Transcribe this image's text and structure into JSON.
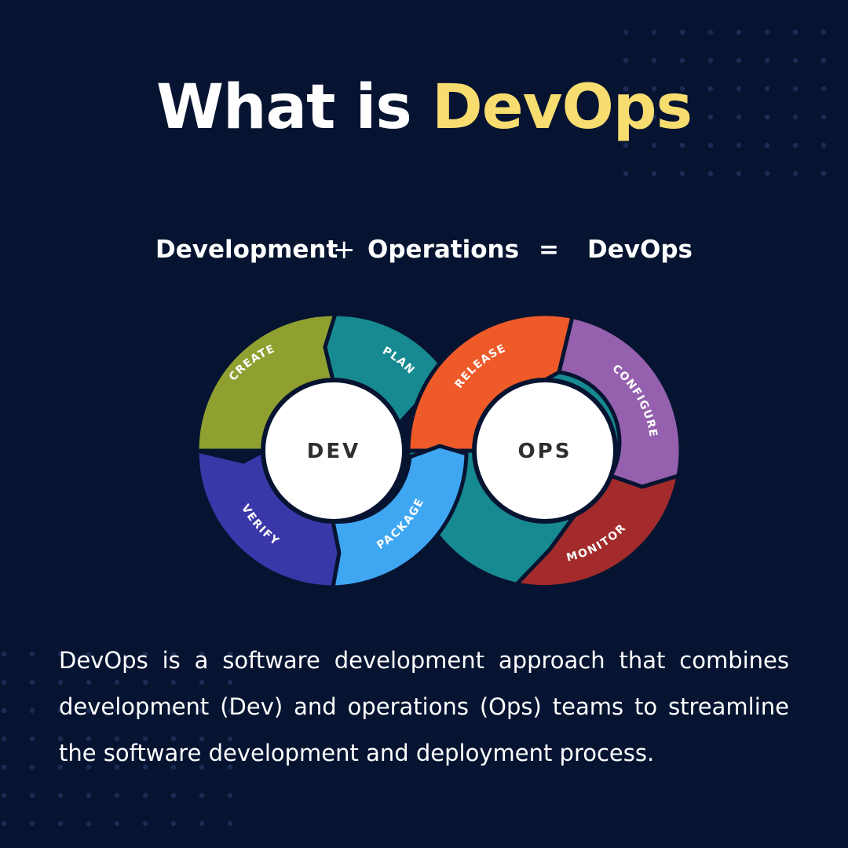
{
  "title": {
    "main": "What is ",
    "accent": "DevOps"
  },
  "equation": {
    "left_term": "Development",
    "operator": "+",
    "right_term": "Operations",
    "equals": "=",
    "result": "DevOps"
  },
  "diagram": {
    "dev_label": "DEV",
    "ops_label": "OPS",
    "stages": {
      "create": "CREATE",
      "plan": "PLAN",
      "verify": "VERIFY",
      "package": "PACKAGE",
      "release": "RELEASE",
      "configure": "CONFIGURE",
      "monitor": "MONITOR"
    }
  },
  "description": "DevOps is a software development approach that combines development (Dev) and operations (Ops) teams to streamline the software development and deployment process.",
  "colors": {
    "background": "#061431",
    "accent": "#F7DC6F",
    "create": "#8FA031",
    "plan": "#178A91",
    "verify": "#3A37A8",
    "package": "#3FA6F2",
    "release": "#EE5A28",
    "configure": "#9560AE",
    "monitor": "#A32B2B",
    "connector": "#178A91"
  }
}
